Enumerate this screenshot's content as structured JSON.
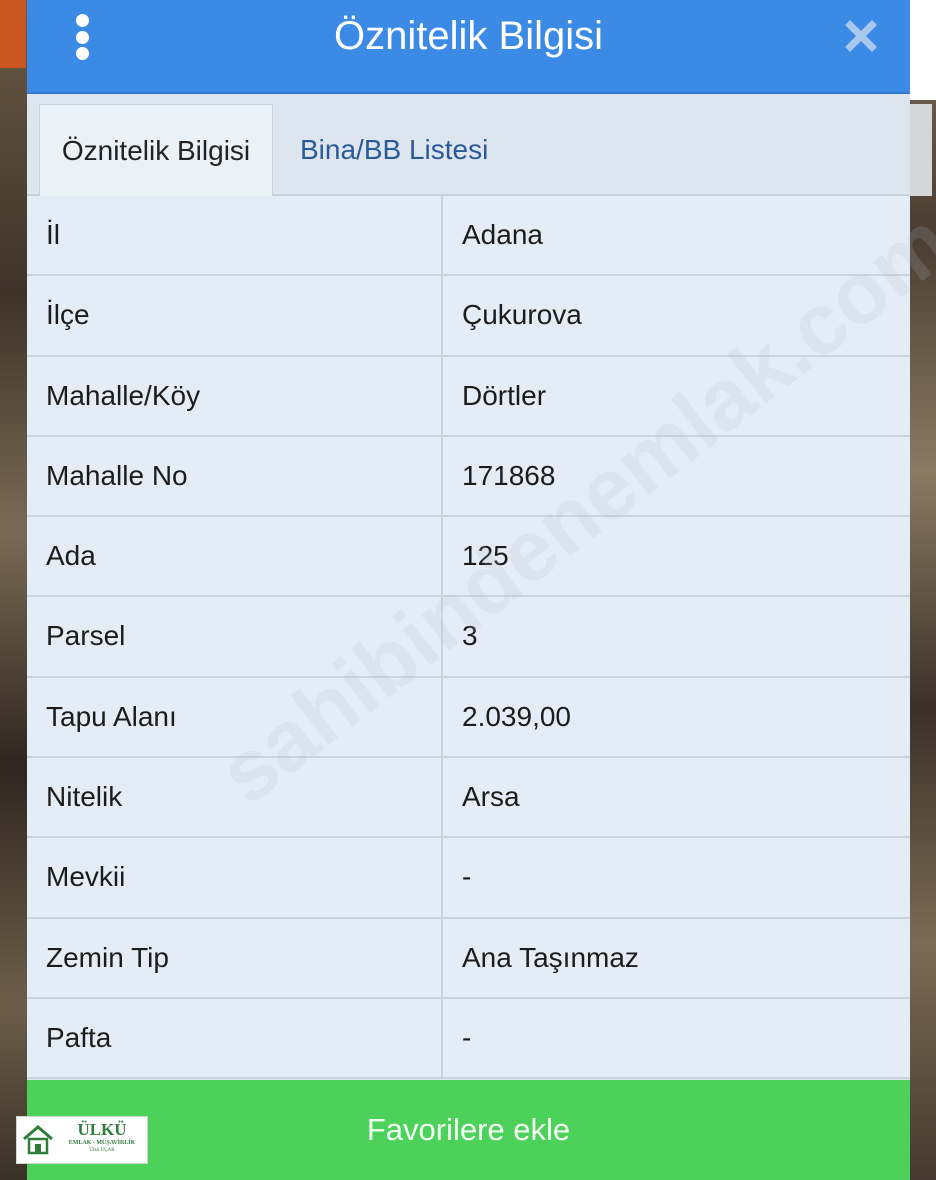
{
  "dialog": {
    "title": "Öznitelik Bilgisi",
    "menu_icon": "vertical-dots-icon",
    "close_icon": "close-icon"
  },
  "tabs": [
    {
      "label": "Öznitelik Bilgisi",
      "active": true
    },
    {
      "label": "Bina/BB Listesi",
      "active": false
    }
  ],
  "attributes": [
    {
      "key": "İl",
      "value": "Adana"
    },
    {
      "key": "İlçe",
      "value": "Çukurova"
    },
    {
      "key": "Mahalle/Köy",
      "value": "Dörtler"
    },
    {
      "key": "Mahalle No",
      "value": "171868"
    },
    {
      "key": "Ada",
      "value": "125"
    },
    {
      "key": "Parsel",
      "value": "3"
    },
    {
      "key": "Tapu Alanı",
      "value": "2.039,00"
    },
    {
      "key": "Nitelik",
      "value": "Arsa"
    },
    {
      "key": "Mevkii",
      "value": "-"
    },
    {
      "key": "Zemin Tip",
      "value": "Ana Taşınmaz"
    },
    {
      "key": "Pafta",
      "value": "-"
    }
  ],
  "favorite_button": {
    "label": "Favorilere ekle"
  },
  "watermark": {
    "text": "sahibindenemlak.com"
  },
  "logo": {
    "name": "ÜLKÜ",
    "subtitle": "EMLAK - MÜŞAVİRLİK",
    "person": "Ülkü UÇAR"
  },
  "colors": {
    "titlebar": "#3a8ae6",
    "favorite_button": "#4cd25a",
    "tab_link": "#2b5a9a"
  }
}
